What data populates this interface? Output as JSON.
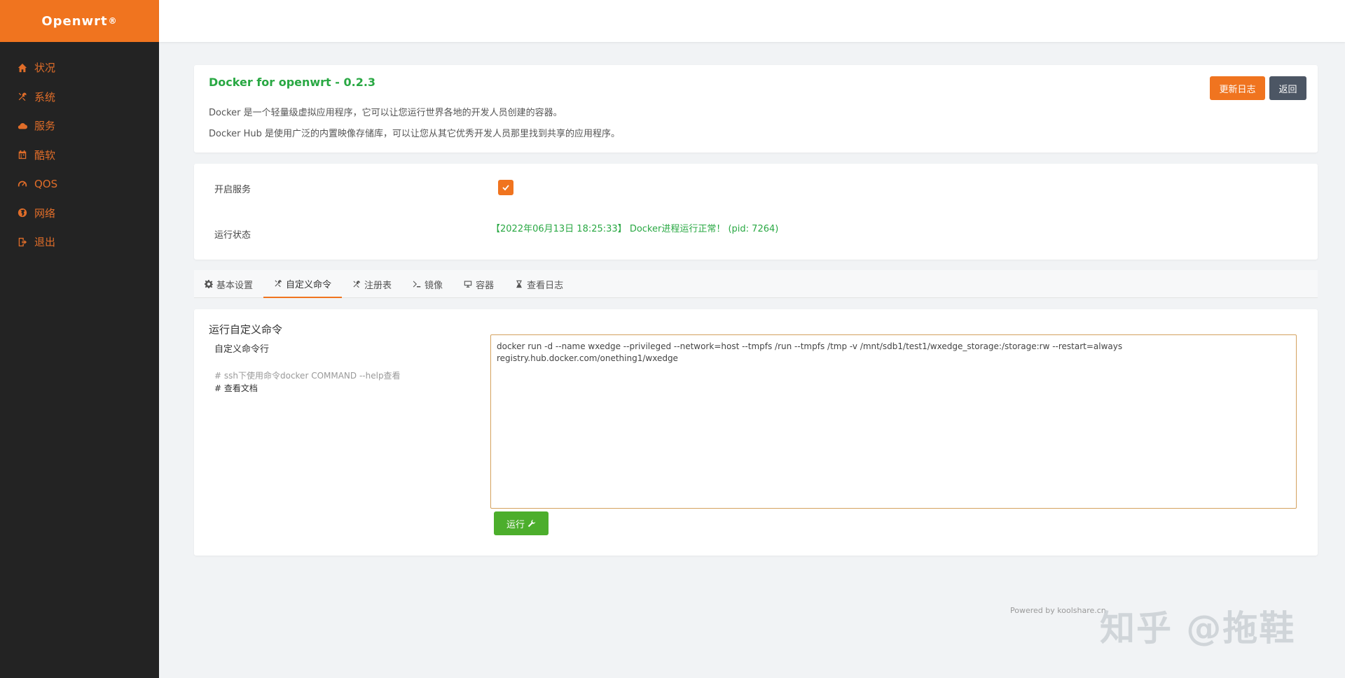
{
  "brand": {
    "name": "Openwrt",
    "mark": "®"
  },
  "sidebar": {
    "items": [
      {
        "label": "状况",
        "icon": "home-icon"
      },
      {
        "label": "系统",
        "icon": "tools-icon"
      },
      {
        "label": "服务",
        "icon": "cloud-icon"
      },
      {
        "label": "酷软",
        "icon": "calendar-icon"
      },
      {
        "label": "QOS",
        "icon": "gauge-icon"
      },
      {
        "label": "网络",
        "icon": "globe-icon"
      },
      {
        "label": "退出",
        "icon": "logout-icon"
      }
    ]
  },
  "header": {
    "title": "Docker for openwrt - 0.2.3",
    "desc1": "Docker 是一个轻量级虚拟应用程序，它可以让您运行世界各地的开发人员创建的容器。",
    "desc2": "Docker Hub 是使用广泛的内置映像存储库，可以让您从其它优秀开发人员那里找到共享的应用程序。",
    "log_button": "更新日志",
    "back_button": "返回"
  },
  "status": {
    "enable_label": "开启服务",
    "enabled": true,
    "run_label": "运行状态",
    "run_text": "【2022年06月13日 18:25:33】 Docker进程运行正常！ (pid: 7264)"
  },
  "tabs": [
    {
      "label": "基本设置",
      "icon": "gear-icon",
      "active": false
    },
    {
      "label": "自定义命令",
      "icon": "tools-icon",
      "active": true
    },
    {
      "label": "注册表",
      "icon": "tools-icon",
      "active": false
    },
    {
      "label": "镜像",
      "icon": "terminal-icon",
      "active": false
    },
    {
      "label": "容器",
      "icon": "monitor-icon",
      "active": false
    },
    {
      "label": "查看日志",
      "icon": "hourglass-icon",
      "active": false
    }
  ],
  "command": {
    "section_title": "运行自定义命令",
    "field_label": "自定义命令行",
    "hint": "# ssh下使用命令docker COMMAND --help查看",
    "doc_link": "# 查看文档",
    "value": "docker run -d --name wxedge --privileged --network=host --tmpfs /run --tmpfs /tmp -v /mnt/sdb1/test1/wxedge_storage:/storage:rw --restart=always registry.hub.docker.com/onething1/wxedge",
    "run_button": "运行"
  },
  "footer": {
    "text": "Powered by koolshare.cn"
  },
  "watermark": {
    "text": "知乎 @拖鞋"
  }
}
